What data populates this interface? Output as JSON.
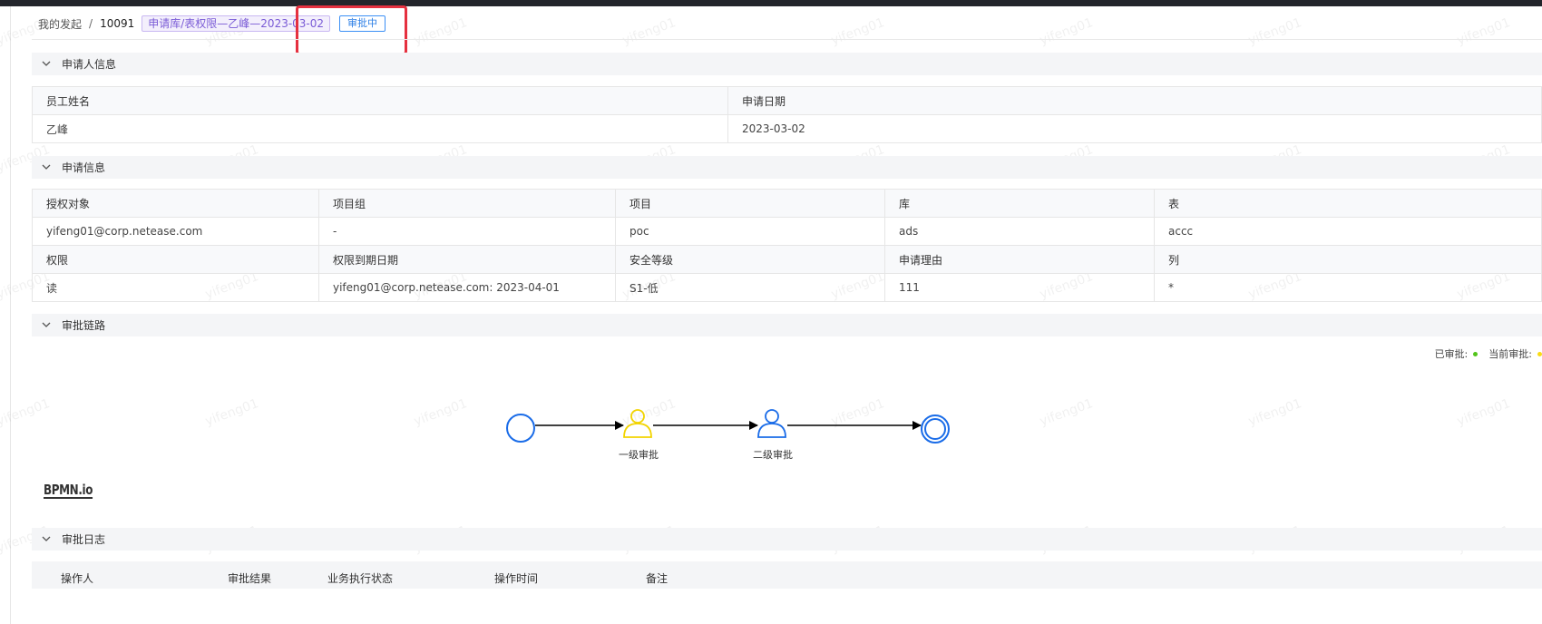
{
  "breadcrumb": {
    "root": "我的发起",
    "separator": "/",
    "id": "10091",
    "title": "申请库/表权限—乙峰—2023-03-02",
    "status": "审批中"
  },
  "applicant_section": {
    "title": "申请人信息",
    "headers": [
      "员工姓名",
      "申请日期"
    ],
    "values": [
      "乙峰",
      "2023-03-02"
    ]
  },
  "request_section": {
    "title": "申请信息",
    "row1_headers": [
      "授权对象",
      "项目组",
      "项目",
      "库",
      "表"
    ],
    "row1_values": [
      "yifeng01@corp.netease.com",
      "-",
      "poc",
      "ads",
      "accc"
    ],
    "row2_headers": [
      "权限",
      "权限到期日期",
      "安全等级",
      "申请理由",
      "列"
    ],
    "row2_values": [
      "读",
      "yifeng01@corp.netease.com: 2023-04-01",
      "S1-低",
      "111",
      "*"
    ]
  },
  "approval_chain": {
    "title": "审批链路",
    "legend": [
      {
        "label": "已审批:",
        "color": "#52c41a"
      },
      {
        "label": "当前审批:",
        "color": "#fadb14"
      }
    ],
    "nodes": [
      "一级审批",
      "二级审批"
    ],
    "logo": "BPMN.io"
  },
  "approval_log": {
    "title": "审批日志",
    "headers": [
      "操作人",
      "审批结果",
      "业务执行状态",
      "操作时间",
      "备注"
    ]
  },
  "watermark_text": "yifeng01"
}
